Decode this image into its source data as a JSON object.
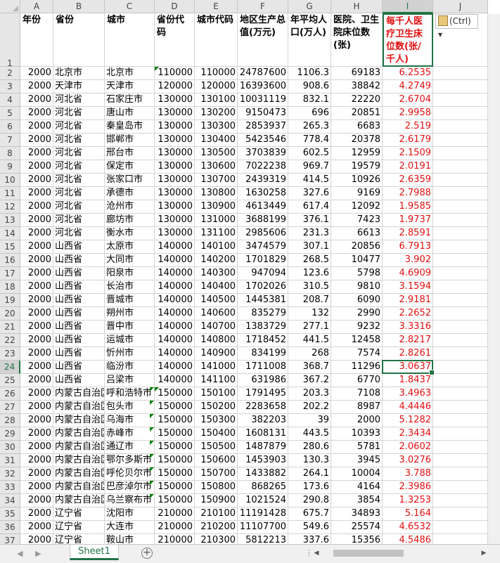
{
  "columns": [
    "A",
    "B",
    "C",
    "D",
    "E",
    "F",
    "G",
    "H",
    "I",
    "J"
  ],
  "selected_column": "I",
  "selected_row": 24,
  "header_row": {
    "row_number": 1,
    "cells": [
      "年份",
      "省份",
      "城市",
      "省份代码",
      "城市代码",
      "地区生产总值(万元)",
      "年平均人口(万人)",
      "医院、卫生院床位数(张)",
      "每千人医疗卫生床位数(张/千人)"
    ]
  },
  "rows": [
    {
      "n": 2,
      "cells": [
        "2000",
        "北京市",
        "北京市",
        "110000",
        "110000",
        "24787600",
        "1106.3",
        "69183",
        "6.2535"
      ]
    },
    {
      "n": 3,
      "cells": [
        "2000",
        "天津市",
        "天津市",
        "120000",
        "120000",
        "16393600",
        "908.6",
        "38842",
        "4.2749"
      ]
    },
    {
      "n": 4,
      "cells": [
        "2000",
        "河北省",
        "石家庄市",
        "130000",
        "130100",
        "10031119",
        "832.1",
        "22220",
        "2.6704"
      ]
    },
    {
      "n": 5,
      "cells": [
        "2000",
        "河北省",
        "唐山市",
        "130000",
        "130200",
        "9150473",
        "696",
        "20851",
        "2.9958"
      ]
    },
    {
      "n": 6,
      "cells": [
        "2000",
        "河北省",
        "秦皇岛市",
        "130000",
        "130300",
        "2853937",
        "265.3",
        "6683",
        "2.519"
      ]
    },
    {
      "n": 7,
      "cells": [
        "2000",
        "河北省",
        "邯郸市",
        "130000",
        "130400",
        "5423546",
        "778.4",
        "20378",
        "2.6179"
      ]
    },
    {
      "n": 8,
      "cells": [
        "2000",
        "河北省",
        "邢台市",
        "130000",
        "130500",
        "3703839",
        "602.5",
        "12959",
        "2.1509"
      ]
    },
    {
      "n": 9,
      "cells": [
        "2000",
        "河北省",
        "保定市",
        "130000",
        "130600",
        "7022238",
        "969.7",
        "19579",
        "2.0191"
      ]
    },
    {
      "n": 10,
      "cells": [
        "2000",
        "河北省",
        "张家口市",
        "130000",
        "130700",
        "2439319",
        "414.5",
        "10926",
        "2.6359"
      ]
    },
    {
      "n": 11,
      "cells": [
        "2000",
        "河北省",
        "承德市",
        "130000",
        "130800",
        "1630258",
        "327.6",
        "9169",
        "2.7988"
      ]
    },
    {
      "n": 12,
      "cells": [
        "2000",
        "河北省",
        "沧州市",
        "130000",
        "130900",
        "4613449",
        "617.4",
        "12092",
        "1.9585"
      ]
    },
    {
      "n": 13,
      "cells": [
        "2000",
        "河北省",
        "廊坊市",
        "130000",
        "131000",
        "3688199",
        "376.1",
        "7423",
        "1.9737"
      ]
    },
    {
      "n": 14,
      "cells": [
        "2000",
        "河北省",
        "衡水市",
        "130000",
        "131100",
        "2985606",
        "231.3",
        "6613",
        "2.8591"
      ]
    },
    {
      "n": 15,
      "cells": [
        "2000",
        "山西省",
        "太原市",
        "140000",
        "140100",
        "3474579",
        "307.1",
        "20856",
        "6.7913"
      ]
    },
    {
      "n": 16,
      "cells": [
        "2000",
        "山西省",
        "大同市",
        "140000",
        "140200",
        "1701829",
        "268.5",
        "10477",
        "3.902"
      ]
    },
    {
      "n": 17,
      "cells": [
        "2000",
        "山西省",
        "阳泉市",
        "140000",
        "140300",
        "947094",
        "123.6",
        "5798",
        "4.6909"
      ]
    },
    {
      "n": 18,
      "cells": [
        "2000",
        "山西省",
        "长治市",
        "140000",
        "140400",
        "1702026",
        "310.5",
        "9810",
        "3.1594"
      ]
    },
    {
      "n": 19,
      "cells": [
        "2000",
        "山西省",
        "晋城市",
        "140000",
        "140500",
        "1445381",
        "208.7",
        "6090",
        "2.9181"
      ]
    },
    {
      "n": 20,
      "cells": [
        "2000",
        "山西省",
        "朔州市",
        "140000",
        "140600",
        "835279",
        "132",
        "2990",
        "2.2652"
      ]
    },
    {
      "n": 21,
      "cells": [
        "2000",
        "山西省",
        "晋中市",
        "140000",
        "140700",
        "1383729",
        "277.1",
        "9232",
        "3.3316"
      ]
    },
    {
      "n": 22,
      "cells": [
        "2000",
        "山西省",
        "运城市",
        "140000",
        "140800",
        "1718452",
        "441.5",
        "12458",
        "2.8217"
      ]
    },
    {
      "n": 23,
      "cells": [
        "2000",
        "山西省",
        "忻州市",
        "140000",
        "140900",
        "834199",
        "268",
        "7574",
        "2.8261"
      ]
    },
    {
      "n": 24,
      "cells": [
        "2000",
        "山西省",
        "临汾市",
        "140000",
        "141000",
        "1711008",
        "368.7",
        "11296",
        "3.0637"
      ]
    },
    {
      "n": 25,
      "cells": [
        "2000",
        "山西省",
        "吕梁市",
        "140000",
        "141100",
        "631986",
        "367.2",
        "6770",
        "1.8437"
      ]
    },
    {
      "n": 26,
      "cells": [
        "2000",
        "内蒙古自治区",
        "呼和浩特市",
        "150000",
        "150100",
        "1791495",
        "203.3",
        "7108",
        "3.4963"
      ]
    },
    {
      "n": 27,
      "cells": [
        "2000",
        "内蒙古自治区",
        "包头市",
        "150000",
        "150200",
        "2283658",
        "202.2",
        "8987",
        "4.4446"
      ]
    },
    {
      "n": 28,
      "cells": [
        "2000",
        "内蒙古自治区",
        "乌海市",
        "150000",
        "150300",
        "382203",
        "39",
        "2000",
        "5.1282"
      ]
    },
    {
      "n": 29,
      "cells": [
        "2000",
        "内蒙古自治区",
        "赤峰市",
        "150000",
        "150400",
        "1608131",
        "443.5",
        "10393",
        "2.3434"
      ]
    },
    {
      "n": 30,
      "cells": [
        "2000",
        "内蒙古自治区",
        "通辽市",
        "150000",
        "150500",
        "1487879",
        "280.6",
        "5781",
        "2.0602"
      ]
    },
    {
      "n": 31,
      "cells": [
        "2000",
        "内蒙古自治区",
        "鄂尔多斯市",
        "150000",
        "150600",
        "1453903",
        "130.3",
        "3945",
        "3.0276"
      ]
    },
    {
      "n": 32,
      "cells": [
        "2000",
        "内蒙古自治区",
        "呼伦贝尔市",
        "150000",
        "150700",
        "1433882",
        "264.1",
        "10004",
        "3.788"
      ]
    },
    {
      "n": 33,
      "cells": [
        "2000",
        "内蒙古自治区",
        "巴彦淖尔市",
        "150000",
        "150800",
        "868265",
        "173.6",
        "4164",
        "2.3986"
      ]
    },
    {
      "n": 34,
      "cells": [
        "2000",
        "内蒙古自治区",
        "乌兰察布市",
        "150000",
        "150900",
        "1021524",
        "290.8",
        "3854",
        "1.3253"
      ]
    },
    {
      "n": 35,
      "cells": [
        "2000",
        "辽宁省",
        "沈阳市",
        "210000",
        "210100",
        "11191428",
        "675.7",
        "34893",
        "5.164"
      ]
    },
    {
      "n": 36,
      "cells": [
        "2000",
        "辽宁省",
        "大连市",
        "210000",
        "210200",
        "11107700",
        "549.6",
        "25574",
        "4.6532"
      ]
    },
    {
      "n": 37,
      "cells": [
        "2000",
        "辽宁省",
        "鞍山市",
        "210000",
        "210300",
        "5812213",
        "337.6",
        "15356",
        "4.5486"
      ]
    }
  ],
  "paste_options_label": "(Ctrl)",
  "sheet_tab_label": "Sheet1",
  "add_sheet_label": "+",
  "colors": {
    "accent_green": "#217346",
    "red_text": "#e01010"
  }
}
